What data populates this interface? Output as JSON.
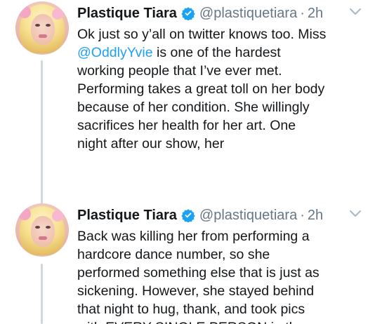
{
  "tweets": [
    {
      "author": {
        "name": "Plastique Tiara",
        "handle": "@plastiquetiara",
        "time": "2h",
        "verified": true
      },
      "text_before": "Ok just so y’all on twitter knows too. Miss\n",
      "mention": "@OddlyYvie",
      "text_after": " is one of the hardest\nworking people that I’ve ever met.\nPerforming takes a great toll on her body\nbecause of her condition. She willingly\nsacrifices her health for her art. One\nnight after our show, her"
    },
    {
      "author": {
        "name": "Plastique Tiara",
        "handle": "@plastiquetiara",
        "time": "2h",
        "verified": true
      },
      "text": "Back was killing her from performing a\nhardcore dance number, so she\nperformed something else that is just as\nsickening. However, she stayed behind\nthat night to hug, thank, and took pics\nwith EVERY SINGLE PERSON in the"
    }
  ],
  "separator": "·",
  "colors": {
    "accent": "#1da1f2",
    "verified": "#1da1f2",
    "secondary_text": "#657786",
    "thread_line": "#cfd8de"
  },
  "icons": {
    "verified": "verified-badge-icon",
    "menu": "chevron-down-icon"
  }
}
